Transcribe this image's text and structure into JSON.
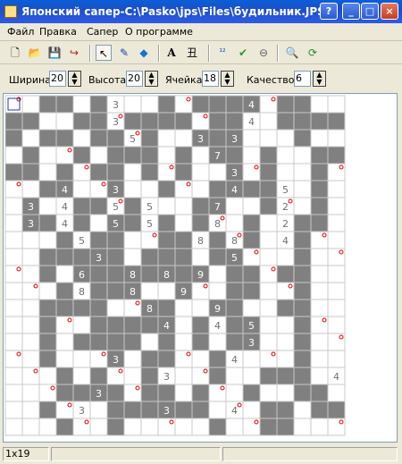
{
  "window": {
    "title": "Японский сапер-C:\\Pasko\\jps\\Files\\будильник.JPS"
  },
  "window_buttons": {
    "help": "?",
    "minimize": "_",
    "maximize": "□",
    "close": "×"
  },
  "menu": [
    "Файл",
    "Правка",
    "Сапер",
    "О программе"
  ],
  "toolbar": {
    "items": [
      {
        "name": "new-file-icon",
        "glyph": "🗋"
      },
      {
        "name": "open-folder-icon",
        "glyph": "📂"
      },
      {
        "name": "save-icon",
        "glyph": "💾"
      },
      {
        "name": "exit-icon",
        "glyph": "↪"
      },
      {
        "name": "pointer-tool-icon",
        "glyph": "↖"
      },
      {
        "name": "pencil-tool-icon",
        "glyph": "✎"
      },
      {
        "name": "eraser-tool-icon",
        "glyph": "◆"
      },
      {
        "name": "text-tool-icon",
        "glyph": "A"
      },
      {
        "name": "grid-text-tool-icon",
        "glyph": "丑"
      },
      {
        "name": "numbers-tool-icon",
        "glyph": "¹²"
      },
      {
        "name": "check-icon",
        "glyph": "✔"
      },
      {
        "name": "stop-icon",
        "glyph": "⊖"
      },
      {
        "name": "zoom-icon",
        "glyph": "🔍"
      },
      {
        "name": "refresh-icon",
        "glyph": "⟳"
      }
    ]
  },
  "params": {
    "width_label": "Ширина",
    "width_value": "20",
    "height_label": "Высота",
    "height_value": "20",
    "cell_label": "Ячейка",
    "cell_value": "18",
    "quality_label": "Качество",
    "quality_value": "6"
  },
  "status": {
    "position": "1x19",
    "panel2": "",
    "panel3": ""
  },
  "colors": {
    "filled": "#808080",
    "mine": "#e00000",
    "grid": "#c8c8c8",
    "number_light": "#707070",
    "number_dark": "#ffffff"
  },
  "board": {
    "rows": [
      "......3.......4.....",
      "......3.......4.....",
      ".......5...3.3......",
      "............7.......",
      ".............3......",
      "...4..3......4..5...",
      ".3.4..5.5...7...2...",
      ".3.4..5.5...8...2...",
      "....5......8.8..4...",
      ".....3.......5......",
      "....6..8.8.9........",
      "....8..8..9.........",
      "........8...9.......",
      ".........4..4.5.....",
      "..............3.....",
      "......3......4......",
      ".........3.........4",
      ".....3..............",
      "....3....3...4......",
      "...................."
    ],
    "filled": [
      "..##.#...#.####.##..",
      "##..##.####.##..####",
      "#.##.##.#..###...#..",
      ".#..#.###.#.##.#..##",
      "##.#.##.#.#..#.#..#.",
      "..##..#..#..####..#.",
      ".#..##.#...##..#..#.",
      ".##.#.##.#.#..#..##.",
      "...#.##..##.#.#..#..",
      "..#####.###.##...#..",
      "..#.########.##.##..",
      "...#.###..#..##..#..",
      "..####..##..##..##..",
      "..#..#####.#.##..#..",
      "..#.####.#.#.##..#..",
      "..#...#.##..#....#..",
      "...#.#..#...#..###..",
      "...####.##.#..#..##.",
      "..#...######...##.##",
      "...#..#.....#..##..."
    ]
  }
}
